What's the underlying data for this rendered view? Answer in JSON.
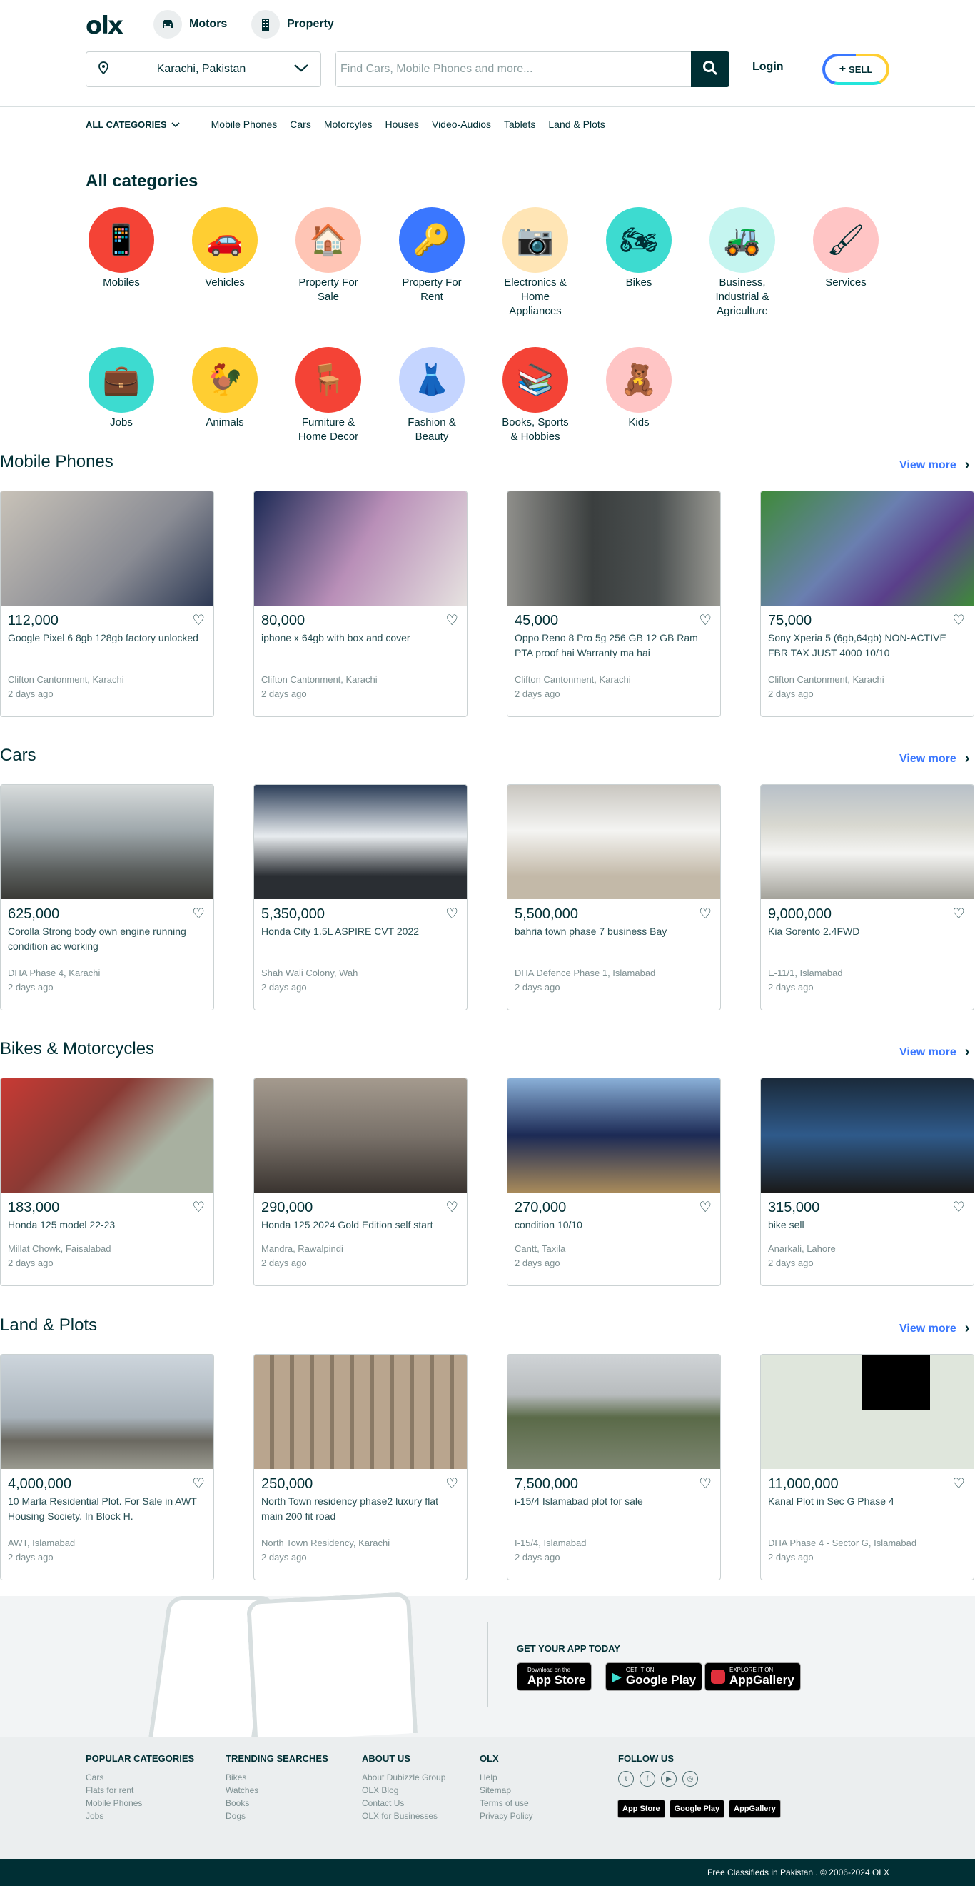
{
  "header": {
    "logo": "olx",
    "verticals": [
      {
        "label": "Motors",
        "icon": "car-icon"
      },
      {
        "label": "Property",
        "icon": "building-icon"
      }
    ],
    "location": "Karachi, Pakistan",
    "search_placeholder": "Find Cars, Mobile Phones and more...",
    "login": "Login",
    "sell": "SELL"
  },
  "catnav": {
    "all_label": "ALL CATEGORIES",
    "items": [
      "Mobile Phones",
      "Cars",
      "Motorcyles",
      "Houses",
      "Video-Audios",
      "Tablets",
      "Land & Plots"
    ]
  },
  "all_categories": {
    "title": "All categories",
    "items": [
      {
        "label": "Mobiles",
        "color": "#f44336"
      },
      {
        "label": "Vehicles",
        "color": "#ffce32"
      },
      {
        "label": "Property For Sale",
        "color": "#ffc5b5"
      },
      {
        "label": "Property For Rent",
        "color": "#3a77ff"
      },
      {
        "label": "Electronics & Home Appliances",
        "color": "#ffe5b5"
      },
      {
        "label": "Bikes",
        "color": "#3ddbd0"
      },
      {
        "label": "Business, Industrial & Agriculture",
        "color": "#c5f5f0"
      },
      {
        "label": "Services",
        "color": "#ffc5c5"
      },
      {
        "label": "Jobs",
        "color": "#3ddbd0"
      },
      {
        "label": "Animals",
        "color": "#ffce32"
      },
      {
        "label": "Furniture & Home Decor",
        "color": "#f44336"
      },
      {
        "label": "Fashion & Beauty",
        "color": "#c5d5ff"
      },
      {
        "label": "Books, Sports & Hobbies",
        "color": "#f44336"
      },
      {
        "label": "Kids",
        "color": "#ffc5c5"
      }
    ]
  },
  "sections": [
    {
      "title": "Mobile Phones",
      "view_more": "View more",
      "items": [
        {
          "price": "112,000",
          "title": "Google Pixel 6 8gb 128gb factory unlocked",
          "location": "Clifton Cantonment, Karachi",
          "date": "2 days ago",
          "img": "#8a8c94"
        },
        {
          "price": "80,000",
          "title": "iphone x 64gb with box and cover",
          "location": "Clifton Cantonment, Karachi",
          "date": "2 days ago",
          "img": "#5b4f6b"
        },
        {
          "price": "45,000",
          "title": "Oppo Reno 8 Pro 5g 256 GB 12 GB Ram PTA proof hai Warranty ma hai",
          "location": "Clifton Cantonment, Karachi",
          "date": "2 days ago",
          "img": "#4b5050"
        },
        {
          "price": "75,000",
          "title": "Sony Xperia 5 (6gb,64gb) NON-ACTIVE FBR TAX JUST 4000 10/10",
          "location": "Clifton Cantonment, Karachi",
          "date": "2 days ago",
          "img": "#3f8a3a"
        }
      ]
    },
    {
      "title": "Cars",
      "view_more": "View more",
      "items": [
        {
          "price": "625,000",
          "title": "Corolla Strong body own engine running condition ac working",
          "location": "DHA Phase 4, Karachi",
          "date": "2 days ago",
          "img": "#9fa8ac"
        },
        {
          "price": "5,350,000",
          "title": "Honda City 1.5L ASPIRE CVT 2022",
          "location": "Shah Wali Colony, Wah",
          "date": "2 days ago",
          "img": "#2b3d57"
        },
        {
          "price": "5,500,000",
          "title": "bahria town phase 7 business Bay",
          "location": "DHA Defence Phase 1, Islamabad",
          "date": "2 days ago",
          "img": "#c9c6c0"
        },
        {
          "price": "9,000,000",
          "title": "Kia Sorento 2.4FWD",
          "location": "E-11/1, Islamabad",
          "date": "2 days ago",
          "img": "#a3a29a"
        }
      ]
    },
    {
      "title": "Bikes & Motorcycles",
      "view_more": "View more",
      "items": [
        {
          "price": "183,000",
          "title": "Honda 125 model 22-23",
          "location": "Millat Chowk, Faisalabad",
          "date": "2 days ago",
          "img": "#8a3a34"
        },
        {
          "price": "290,000",
          "title": "Honda 125 2024 Gold Edition self start",
          "location": "Mandra, Rawalpindi",
          "date": "2 days ago",
          "img": "#7a726a"
        },
        {
          "price": "270,000",
          "title": "condition 10/10",
          "location": "Cantt, Taxila",
          "date": "2 days ago",
          "img": "#5a7fa8"
        },
        {
          "price": "315,000",
          "title": "bike sell",
          "location": "Anarkali, Lahore",
          "date": "2 days ago",
          "img": "#2f4a6a"
        }
      ]
    },
    {
      "title": "Land & Plots",
      "view_more": "View more",
      "items": [
        {
          "price": "4,000,000",
          "title": "10 Marla Residential Plot. For Sale in AWT Housing Society. In Block H.",
          "location": "AWT, Islamabad",
          "date": "2 days ago",
          "img": "#a9b3bb"
        },
        {
          "price": "250,000",
          "title": "North Town residency phase2 luxury flat main 200 fit road",
          "location": "North Town Residency, Karachi",
          "date": "2 days ago",
          "img": "#b9a58e"
        },
        {
          "price": "7,500,000",
          "title": "i-15/4 Islamabad plot for sale",
          "location": "I-15/4, Islamabad",
          "date": "2 days ago",
          "img": "#7c8570"
        },
        {
          "price": "11,000,000",
          "title": "Kanal Plot in Sec G Phase 4",
          "location": "DHA Phase 4 - Sector G, Islamabad",
          "date": "2 days ago",
          "img": "#dfe6dc"
        }
      ]
    }
  ],
  "app": {
    "title": "GET YOUR APP TODAY",
    "stores": [
      {
        "small": "Download on the",
        "large": "App Store"
      },
      {
        "small": "GET IT ON",
        "large": "Google Play"
      },
      {
        "small": "EXPLORE IT ON",
        "large": "AppGallery"
      }
    ]
  },
  "footer": {
    "columns": [
      {
        "title": "POPULAR CATEGORIES",
        "links": [
          "Cars",
          "Flats for rent",
          "Mobile Phones",
          "Jobs"
        ]
      },
      {
        "title": "TRENDING SEARCHES",
        "links": [
          "Bikes",
          "Watches",
          "Books",
          "Dogs"
        ]
      },
      {
        "title": "ABOUT US",
        "links": [
          "About Dubizzle Group",
          "OLX Blog",
          "Contact Us",
          "OLX for Businesses"
        ]
      },
      {
        "title": "OLX",
        "links": [
          "Help",
          "Sitemap",
          "Terms of use",
          "Privacy Policy"
        ]
      }
    ],
    "follow_title": "FOLLOW US",
    "copyright": "Free Classifieds in Pakistan . © 2006-2024 OLX"
  }
}
